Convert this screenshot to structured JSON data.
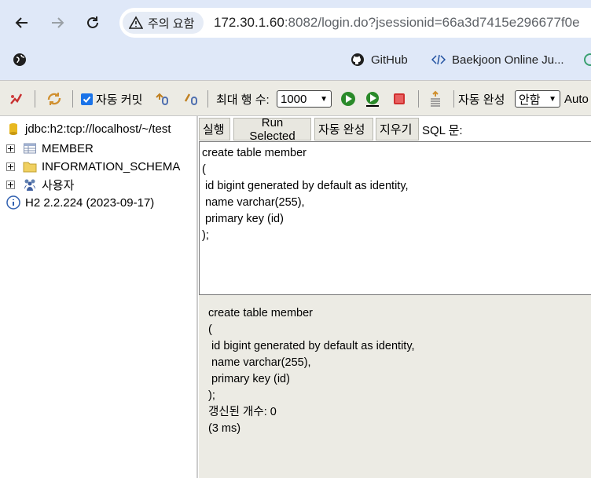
{
  "browser": {
    "security_chip": "주의 요함",
    "url_host": "172.30.1.60",
    "url_rest": ":8082/login.do?jsessionid=66a3d7415e296677f0e",
    "bookmarks": [
      "GitHub",
      "Baekjoon Online Ju..."
    ]
  },
  "toolbar": {
    "autocommit_label": "자동 커밋",
    "max_rows_label": "최대 행 수:",
    "max_rows_value": "1000",
    "autocomplete_label": "자동 완성",
    "autocomplete_value": "안함",
    "auto_label": "Auto"
  },
  "tree": {
    "connection": "jdbc:h2:tcp://localhost/~/test",
    "items": [
      "MEMBER",
      "INFORMATION_SCHEMA",
      "사용자"
    ],
    "version": "H2 2.2.224 (2023-09-17)"
  },
  "sql": {
    "run_label": "실행",
    "run_selected_label": "Run Selected",
    "autocomplete_label": "자동 완성",
    "clear_label": "지우기",
    "statement_label": "SQL 문:",
    "editor_text": "create table member\n(\n id bigint generated by default as identity,\n name varchar(255),\n primary key (id)\n);"
  },
  "result": {
    "text": "create table member\n(\n id bigint generated by default as identity,\n name varchar(255),\n primary key (id)\n);\n갱신된 개수: 0\n(3 ms)"
  }
}
